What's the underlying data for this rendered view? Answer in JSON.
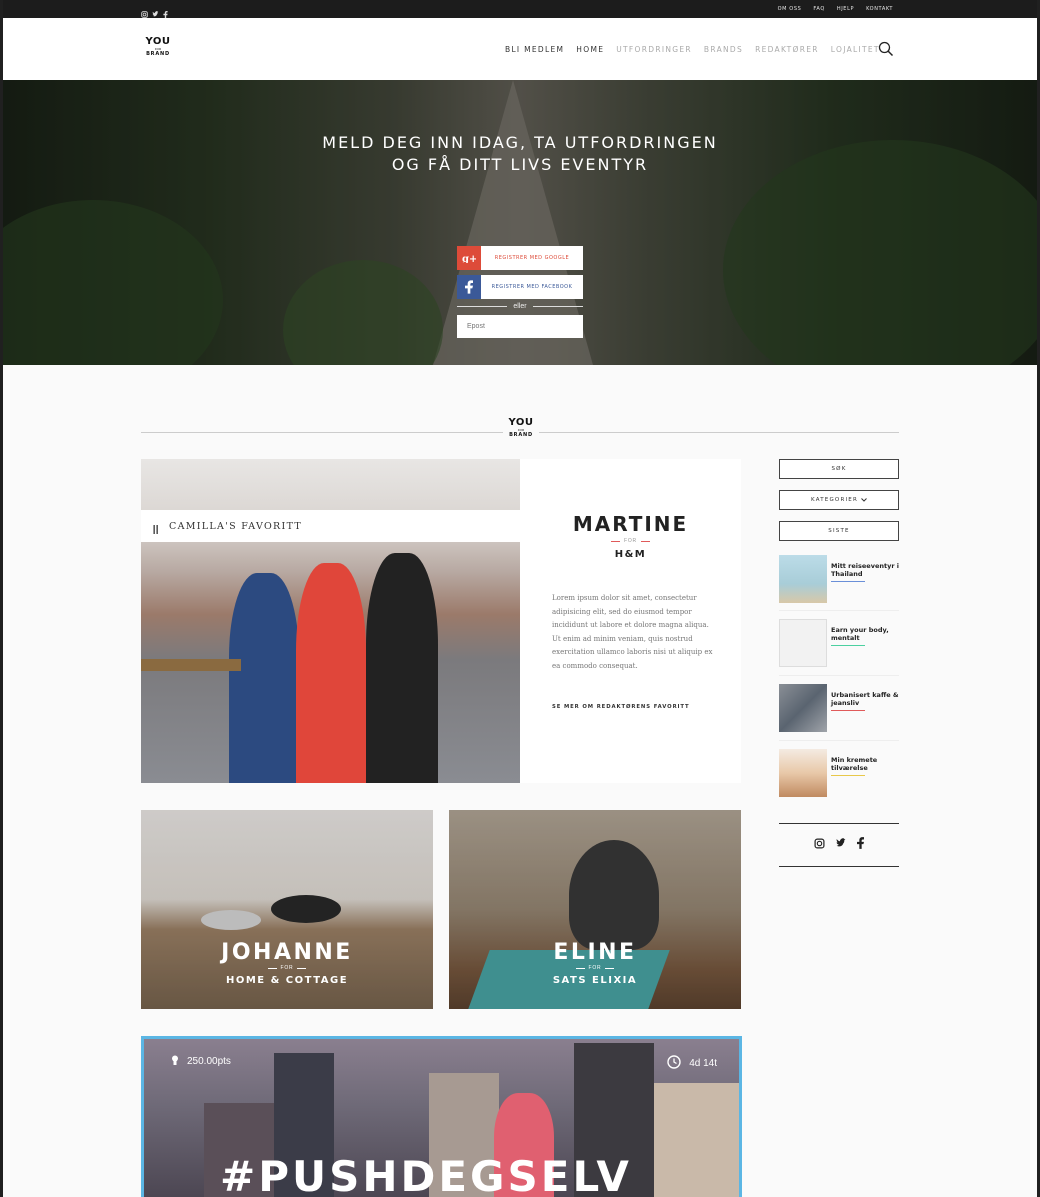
{
  "topbar": {
    "social": [
      "instagram-icon",
      "twitter-icon",
      "facebook-icon"
    ],
    "links": [
      "OM OSS",
      "FAQ",
      "HJELP",
      "KONTAKT"
    ]
  },
  "header": {
    "logo": {
      "line1": "YOU",
      "line2": "FOR",
      "line3": "BRAND"
    },
    "nav": [
      {
        "label": "BLI MEDLEM",
        "active": true
      },
      {
        "label": "HOME",
        "active": true
      },
      {
        "label": "UTFORDRINGER",
        "active": false
      },
      {
        "label": "BRANDS",
        "active": false
      },
      {
        "label": "REDAKTØRER",
        "active": false
      },
      {
        "label": "LOJALITET",
        "active": false
      }
    ],
    "search_icon": "search-icon"
  },
  "hero": {
    "title_line1": "MELD DEG INN IDAG, TA UTFORDRINGEN",
    "title_line2": "OG FÅ DITT LIVS EVENTYR",
    "google_label": "REGISTRER MED GOOGLE",
    "facebook_label": "REGISTRER MED FACEBOOK",
    "or_text": "eller",
    "email_placeholder": "Epost",
    "colors": {
      "google": "#dd4b39",
      "facebook": "#3b5998"
    }
  },
  "section_logo": {
    "line1": "YOU",
    "line2": "FOR",
    "line3": "BRAND"
  },
  "feature": {
    "label": "CAMILLA'S FAVORITT",
    "name": "MARTINE",
    "for": "FOR",
    "brand": "H&M",
    "text": "Lorem ipsum dolor sit amet, consectetur adipisicing elit, sed do eiusmod tempor incididunt ut labore et dolore magna aliqua. Ut enim ad minim veniam, quis nostrud exercitation ullamco laboris nisi ut aliquip ex ea commodo consequat.",
    "more": "SE MER OM REDAKTØRENS FAVORITT"
  },
  "cards": [
    {
      "name": "JOHANNE",
      "for": "FOR",
      "brand": "HOME & COTTAGE"
    },
    {
      "name": "ELINE",
      "for": "FOR",
      "brand": "SATS ELIXIA"
    }
  ],
  "challenge": {
    "points": "250.00pts",
    "time": "4d 14t",
    "tag": "#PUSHDEGSELV",
    "border_color": "#5bb6e4"
  },
  "sidebar": {
    "search": "SØK",
    "categories": "KATEGORIER",
    "latest": "SISTE",
    "posts": [
      {
        "title": "Mitt reiseeventyr i Thailand",
        "color": "#6a8fd8"
      },
      {
        "title": "Earn your body, mentalt",
        "color": "#4cd0a0"
      },
      {
        "title": "Urbanisert kaffe & jeansliv",
        "color": "#e05a5a"
      },
      {
        "title": "Min kremete tilværelse",
        "color": "#e8c84a"
      }
    ],
    "social": [
      "instagram-icon",
      "twitter-icon",
      "facebook-icon"
    ]
  }
}
